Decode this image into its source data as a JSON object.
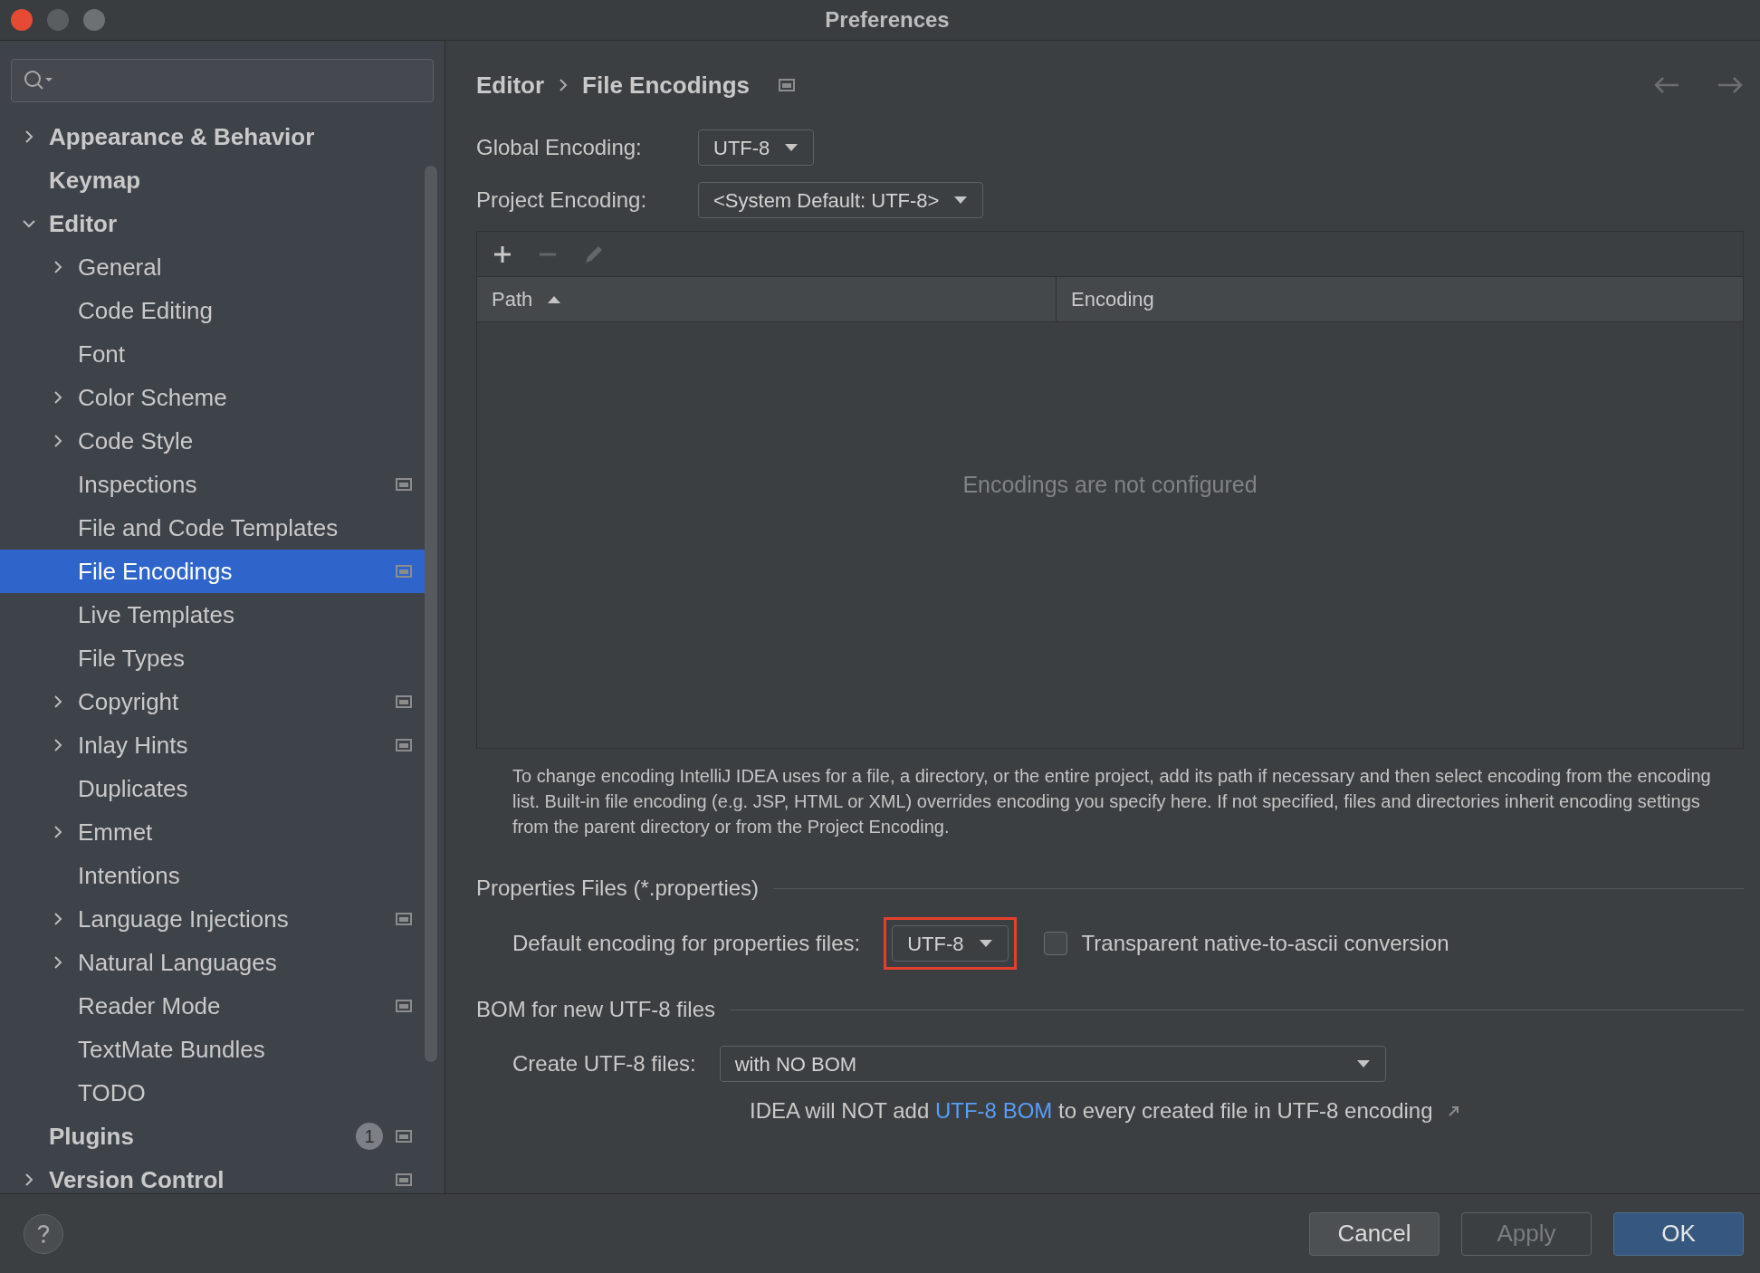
{
  "window": {
    "title": "Preferences"
  },
  "tree": [
    {
      "label": "Appearance & Behavior",
      "kind": "group",
      "expanded": false,
      "selected": false,
      "scoped": false
    },
    {
      "label": "Keymap",
      "kind": "leaf",
      "selected": false,
      "scoped": false
    },
    {
      "label": "Editor",
      "kind": "group",
      "expanded": true,
      "selected": false,
      "scoped": false,
      "children": [
        {
          "label": "General",
          "kind": "group",
          "expanded": false,
          "selected": false,
          "scoped": false
        },
        {
          "label": "Code Editing",
          "kind": "leaf",
          "selected": false,
          "scoped": false
        },
        {
          "label": "Font",
          "kind": "leaf",
          "selected": false,
          "scoped": false
        },
        {
          "label": "Color Scheme",
          "kind": "group",
          "expanded": false,
          "selected": false,
          "scoped": false
        },
        {
          "label": "Code Style",
          "kind": "group",
          "expanded": false,
          "selected": false,
          "scoped": false
        },
        {
          "label": "Inspections",
          "kind": "leaf",
          "selected": false,
          "scoped": true
        },
        {
          "label": "File and Code Templates",
          "kind": "leaf",
          "selected": false,
          "scoped": false
        },
        {
          "label": "File Encodings",
          "kind": "leaf",
          "selected": true,
          "scoped": true
        },
        {
          "label": "Live Templates",
          "kind": "leaf",
          "selected": false,
          "scoped": false
        },
        {
          "label": "File Types",
          "kind": "leaf",
          "selected": false,
          "scoped": false
        },
        {
          "label": "Copyright",
          "kind": "group",
          "expanded": false,
          "selected": false,
          "scoped": true
        },
        {
          "label": "Inlay Hints",
          "kind": "group",
          "expanded": false,
          "selected": false,
          "scoped": true
        },
        {
          "label": "Duplicates",
          "kind": "leaf",
          "selected": false,
          "scoped": false
        },
        {
          "label": "Emmet",
          "kind": "group",
          "expanded": false,
          "selected": false,
          "scoped": false
        },
        {
          "label": "Intentions",
          "kind": "leaf",
          "selected": false,
          "scoped": false
        },
        {
          "label": "Language Injections",
          "kind": "group",
          "expanded": false,
          "selected": false,
          "scoped": true
        },
        {
          "label": "Natural Languages",
          "kind": "group",
          "expanded": false,
          "selected": false,
          "scoped": false
        },
        {
          "label": "Reader Mode",
          "kind": "leaf",
          "selected": false,
          "scoped": true
        },
        {
          "label": "TextMate Bundles",
          "kind": "leaf",
          "selected": false,
          "scoped": false
        },
        {
          "label": "TODO",
          "kind": "leaf",
          "selected": false,
          "scoped": false
        }
      ]
    },
    {
      "label": "Plugins",
      "kind": "leaf",
      "selected": false,
      "scoped": true,
      "badge": "1"
    },
    {
      "label": "Version Control",
      "kind": "group",
      "expanded": false,
      "selected": false,
      "scoped": true
    }
  ],
  "breadcrumb": [
    "Editor",
    "File Encodings"
  ],
  "global_encoding": {
    "label": "Global Encoding:",
    "value": "UTF-8"
  },
  "project_encoding": {
    "label": "Project Encoding:",
    "value": "<System Default: UTF-8>"
  },
  "table": {
    "columns": [
      {
        "label": "Path",
        "sorted": true
      },
      {
        "label": "Encoding",
        "sorted": false
      }
    ],
    "empty_text": "Encodings are not configured"
  },
  "description": "To change encoding IntelliJ IDEA uses for a file, a directory, or the entire project, add its path if necessary and then select encoding from the encoding list. Built-in file encoding (e.g. JSP, HTML or XML) overrides encoding you specify here. If not specified, files and directories inherit encoding settings from the parent directory or from the Project Encoding.",
  "properties_section": {
    "title": "Properties Files (*.properties)",
    "label": "Default encoding for properties files:",
    "value": "UTF-8",
    "highlighted": true,
    "checkbox": {
      "label": "Transparent native-to-ascii conversion",
      "checked": false
    }
  },
  "bom_section": {
    "title": "BOM for new UTF-8 files",
    "label": "Create UTF-8 files:",
    "value": "with NO BOM",
    "note_before": "IDEA will NOT add",
    "note_link": "UTF-8 BOM",
    "note_after": "to every created file in UTF-8 encoding"
  },
  "buttons": [
    {
      "label": "Cancel",
      "kind": "normal"
    },
    {
      "label": "Apply",
      "kind": "disabled"
    },
    {
      "label": "OK",
      "kind": "primary"
    }
  ]
}
